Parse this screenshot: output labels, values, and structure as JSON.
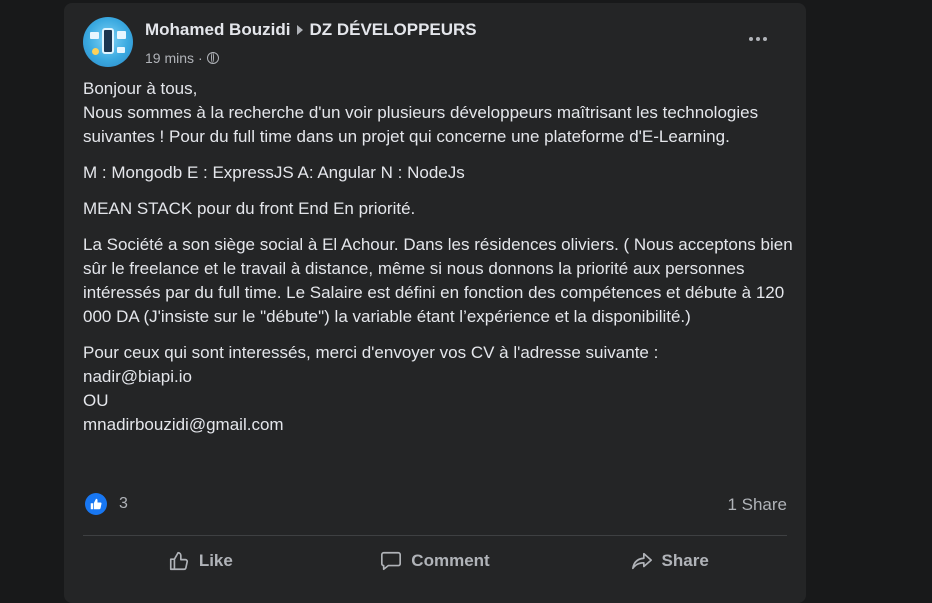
{
  "post": {
    "author": "Mohamed Bouzidi",
    "group": "DZ DÉVELOPPEURS",
    "time": "19 mins",
    "separator": "·",
    "paragraphs": {
      "p1_l1": "Bonjour à tous,",
      "p1_l2": "Nous sommes à la recherche d'un voir plusieurs développeurs maîtrisant les technologies suivantes ! Pour du full time dans un projet qui concerne une plateforme d'E-Learning.",
      "p2": "M : Mongodb E : ExpressJS A: Angular N : NodeJs",
      "p3": "MEAN STACK pour du front End En priorité.",
      "p4": "La Société a son siège social à El Achour. Dans les résidences oliviers. ( Nous acceptons bien sûr le freelance et le travail à distance, même si nous donnons la priorité aux personnes intéressés par du full time. Le Salaire est défini en fonction des compétences et débute à 120 000 DA (J'insiste sur le \"débute\") la variable étant l’expérience et la disponibilité.)",
      "p5_l1": "Pour ceux qui sont interessés, merci d'envoyer vos CV à l'adresse suivante :",
      "p5_l2": "nadir@biapi.io",
      "p5_l3": "OU",
      "p5_l4": "mnadirbouzidi@gmail.com"
    },
    "reaction_count": "3",
    "share_count": "1 Share"
  },
  "actions": {
    "like": "Like",
    "comment": "Comment",
    "share": "Share"
  },
  "icons": {
    "globe": "globe-icon",
    "more": "more-icon",
    "like_reaction": "thumbs-up-icon",
    "like_action": "thumbs-up-outline-icon",
    "comment_action": "speech-bubble-icon",
    "share_action": "share-arrow-icon"
  },
  "colors": {
    "page_bg": "#18191a",
    "card_bg": "#242526",
    "text_primary": "#e4e6eb",
    "text_secondary": "#b0b3b8",
    "accent": "#1877f2"
  }
}
